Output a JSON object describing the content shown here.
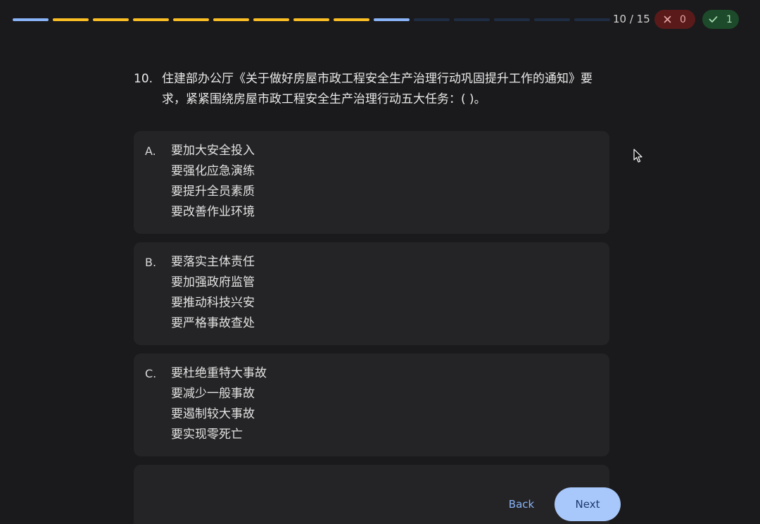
{
  "progress": {
    "segments": [
      "correct",
      "wrong",
      "wrong",
      "wrong",
      "wrong",
      "wrong",
      "wrong",
      "wrong",
      "wrong",
      "current",
      "pending",
      "pending",
      "pending",
      "pending",
      "pending"
    ],
    "counter": "10 / 15",
    "wrong_count": "0",
    "correct_count": "1"
  },
  "colors": {
    "wrong_segment": "#fbbf24",
    "done_segment": "#8ab4f8",
    "pending_segment": "#1f2d44",
    "accent": "#a8c7fa"
  },
  "question": {
    "number": "10.",
    "text": "住建部办公厅《关于做好房屋市政工程安全生产治理行动巩固提升工作的通知》要求，紧紧围绕房屋市政工程安全生产治理行动五大任务：( )。"
  },
  "options": [
    {
      "letter": "A.",
      "lines": [
        "要加大安全投入",
        "要强化应急演练",
        "要提升全员素质",
        "要改善作业环境"
      ]
    },
    {
      "letter": "B.",
      "lines": [
        "要落实主体责任",
        "要加强政府监管",
        "要推动科技兴安",
        "要严格事故查处"
      ]
    },
    {
      "letter": "C.",
      "lines": [
        "要杜绝重特大事故",
        "要减少一般事故",
        "要遏制较大事故",
        "要实现零死亡"
      ]
    }
  ],
  "footer": {
    "back_label": "Back",
    "next_label": "Next"
  },
  "icons": {
    "wrong": "close-icon",
    "correct": "check-icon",
    "pointer": "mouse-cursor-icon"
  }
}
